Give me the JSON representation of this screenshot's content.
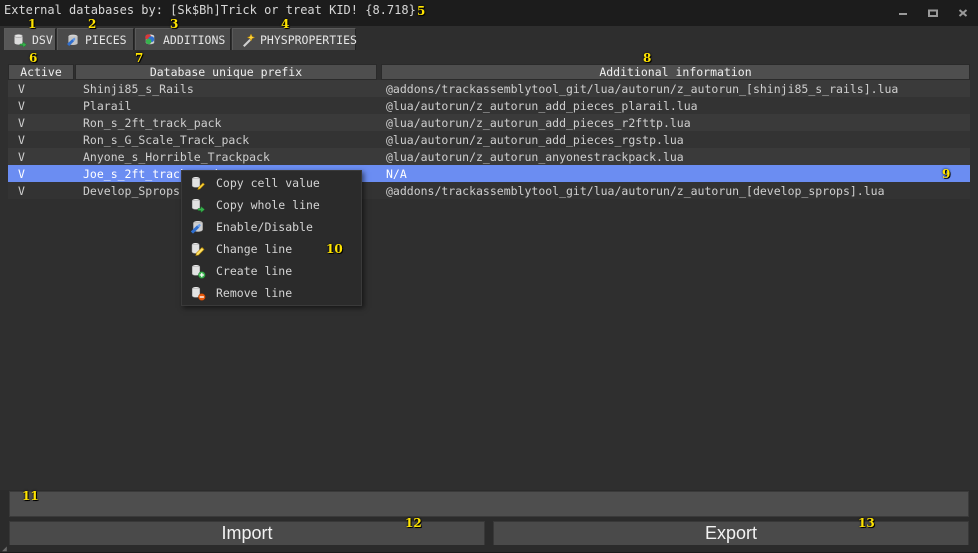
{
  "window": {
    "title": "External databases by: [Sk$Bh]Trick or treat KID! {8.718}",
    "minimize_label": "minimize-icon",
    "maximize_label": "maximize-icon",
    "close_label": "close-icon"
  },
  "tabs": [
    {
      "label": "DSV",
      "icon": "database-export-icon",
      "active": true,
      "anno": "1"
    },
    {
      "label": "PIECES",
      "icon": "database-blue-icon",
      "active": false,
      "anno": "2"
    },
    {
      "label": "ADDITIONS",
      "icon": "database-add-icon",
      "active": false,
      "anno": "3"
    },
    {
      "label": "PHYSPROPERTIES",
      "icon": "magic-wand-icon",
      "active": false,
      "anno": "4"
    }
  ],
  "table": {
    "headers": [
      "Active",
      "Database unique prefix",
      "Additional information"
    ],
    "rows": [
      {
        "active": "V",
        "prefix": "Shinji85_s_Rails",
        "info": "@addons/trackassemblytool_git/lua/autorun/z_autorun_[shinji85_s_rails].lua",
        "selected": false
      },
      {
        "active": "V",
        "prefix": "Plarail",
        "info": "@lua/autorun/z_autorun_add_pieces_plarail.lua",
        "selected": false
      },
      {
        "active": "V",
        "prefix": "Ron_s_2ft_track_pack",
        "info": "@lua/autorun/z_autorun_add_pieces_r2fttp.lua",
        "selected": false
      },
      {
        "active": "V",
        "prefix": "Ron_s_G_Scale_Track_pack",
        "info": "@lua/autorun/z_autorun_add_pieces_rgstp.lua",
        "selected": false
      },
      {
        "active": "V",
        "prefix": "Anyone_s_Horrible_Trackpack",
        "info": "@lua/autorun/z_autorun_anyonestrackpack.lua",
        "selected": false
      },
      {
        "active": "V",
        "prefix": "Joe_s_2ft_track_pack",
        "info": "N/A",
        "selected": true
      },
      {
        "active": "V",
        "prefix": "Develop_Sprops",
        "info": "@addons/trackassemblytool_git/lua/autorun/z_autorun_[develop_sprops].lua",
        "selected": false
      }
    ]
  },
  "context_menu": {
    "items": [
      {
        "label": "Copy cell value",
        "icon": "copy-cell-icon"
      },
      {
        "label": "Copy whole line",
        "icon": "copy-line-icon"
      },
      {
        "label": "Enable/Disable",
        "icon": "enable-disable-icon"
      },
      {
        "label": "Change line",
        "icon": "edit-line-icon"
      },
      {
        "label": "Create line",
        "icon": "create-line-icon"
      },
      {
        "label": "Remove line",
        "icon": "remove-line-icon"
      }
    ]
  },
  "footer": {
    "status_value": "",
    "import_label": "Import",
    "export_label": "Export"
  },
  "annotations": {
    "a1": "1",
    "a2": "2",
    "a3": "3",
    "a4": "4",
    "a5": "5",
    "a6": "6",
    "a7": "7",
    "a8": "8",
    "a9": "9",
    "a10": "10",
    "a11": "11",
    "a12": "12",
    "a13": "13"
  },
  "colors": {
    "accent_selection": "#6b8df2",
    "annotation": "#ffe400",
    "panel": "#2f2f2f",
    "header": "#4e4e4e"
  }
}
